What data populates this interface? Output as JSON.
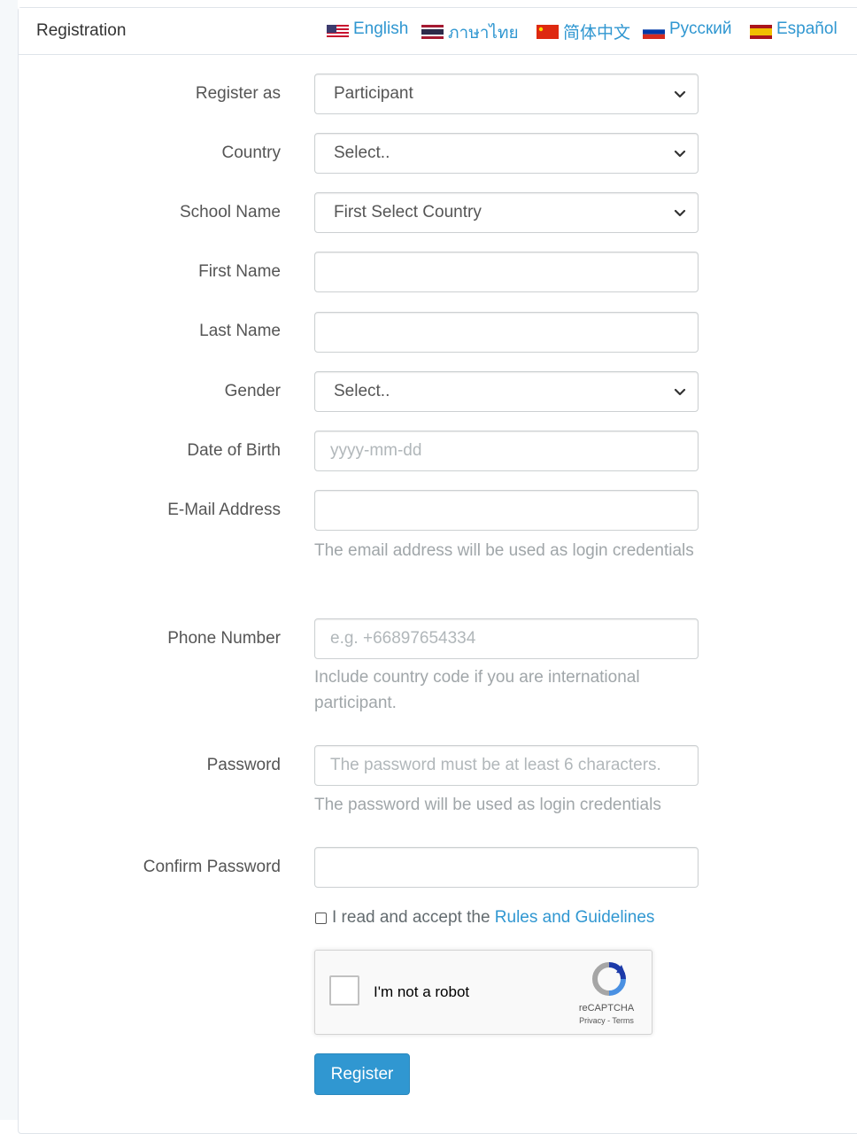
{
  "header": {
    "title": "Registration",
    "languages": [
      {
        "label": "English",
        "flag": "us-flag-icon"
      },
      {
        "label": "ภาษาไทย",
        "flag": "thai-flag-icon"
      },
      {
        "label": "简体中文",
        "flag": "china-flag-icon"
      },
      {
        "label": "Русский",
        "flag": "russia-flag-icon"
      },
      {
        "label": "Español",
        "flag": "spain-flag-icon"
      }
    ]
  },
  "form": {
    "register_as": {
      "label": "Register as",
      "value": "Participant"
    },
    "country": {
      "label": "Country",
      "value": "Select.."
    },
    "school_name": {
      "label": "School Name",
      "value": "First Select Country"
    },
    "first_name": {
      "label": "First Name",
      "value": "",
      "placeholder": ""
    },
    "last_name": {
      "label": "Last Name",
      "value": "",
      "placeholder": ""
    },
    "gender": {
      "label": "Gender",
      "value": "Select.."
    },
    "dob": {
      "label": "Date of Birth",
      "value": "",
      "placeholder": "yyyy-mm-dd"
    },
    "email": {
      "label": "E-Mail Address",
      "value": "",
      "placeholder": "",
      "help": "The email address will be used as login credentials"
    },
    "phone": {
      "label": "Phone Number",
      "value": "",
      "placeholder": "e.g. +66897654334",
      "help": "Include country code if you are international participant."
    },
    "password": {
      "label": "Password",
      "value": "",
      "placeholder": "The password must be at least 6 characters.",
      "help": "The password will be used as login credentials"
    },
    "confirm_password": {
      "label": "Confirm Password",
      "value": "",
      "placeholder": ""
    },
    "agree": {
      "text": "I read and accept the ",
      "link": "Rules and Guidelines"
    },
    "captcha": {
      "label": "I'm not a robot",
      "brand": "reCAPTCHA",
      "terms": "Privacy - Terms"
    },
    "submit_label": "Register"
  },
  "colors": {
    "accent": "#3097d1",
    "border": "#ccd0d2"
  }
}
